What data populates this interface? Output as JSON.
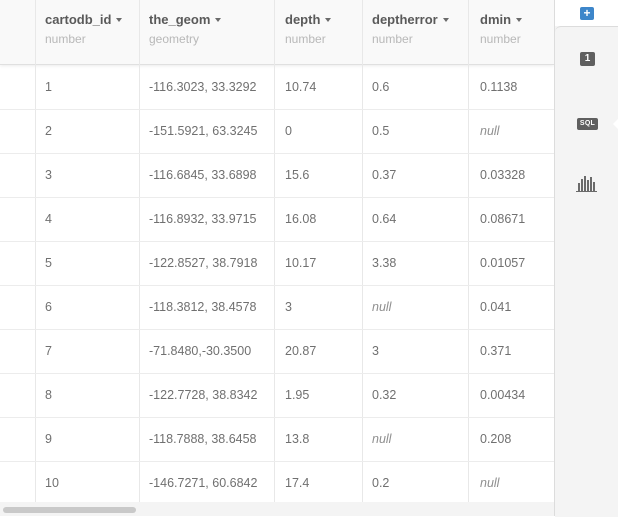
{
  "table": {
    "columns": [
      {
        "name": "cartodb_id",
        "type": "number"
      },
      {
        "name": "the_geom",
        "type": "geometry"
      },
      {
        "name": "depth",
        "type": "number"
      },
      {
        "name": "deptherror",
        "type": "number"
      },
      {
        "name": "dmin",
        "type": "number"
      }
    ],
    "rows": [
      [
        "1",
        "-116.3023, 33.3292",
        "10.74",
        "0.6",
        "0.1138"
      ],
      [
        "2",
        "-151.5921, 63.3245",
        "0",
        "0.5",
        "null"
      ],
      [
        "3",
        "-116.6845, 33.6898",
        "15.6",
        "0.37",
        "0.03328"
      ],
      [
        "4",
        "-116.8932, 33.9715",
        "16.08",
        "0.64",
        "0.08671"
      ],
      [
        "5",
        "-122.8527, 38.7918",
        "10.17",
        "3.38",
        "0.01057"
      ],
      [
        "6",
        "-118.3812, 38.4578",
        "3",
        "null",
        "0.041"
      ],
      [
        "7",
        "-71.8480,-30.3500",
        "20.87",
        "3",
        "0.371"
      ],
      [
        "8",
        "-122.7728, 38.8342",
        "1.95",
        "0.32",
        "0.00434"
      ],
      [
        "9",
        "-118.7888, 38.6458",
        "13.8",
        "null",
        "0.208"
      ],
      [
        "10",
        "-146.7271, 60.6842",
        "17.4",
        "0.2",
        "null"
      ]
    ]
  },
  "side_panel": {
    "add_label": "+",
    "layer_count": "1",
    "sql_label": "SQL",
    "icons": {
      "add": "plus-icon",
      "layers": "layer-count-badge",
      "sql": "sql-icon",
      "widgets": "histogram-icon"
    }
  },
  "colors": {
    "accent": "#3d86ca",
    "header_bg": "#f9f9f9",
    "panel_bg": "#f4f4f4"
  }
}
